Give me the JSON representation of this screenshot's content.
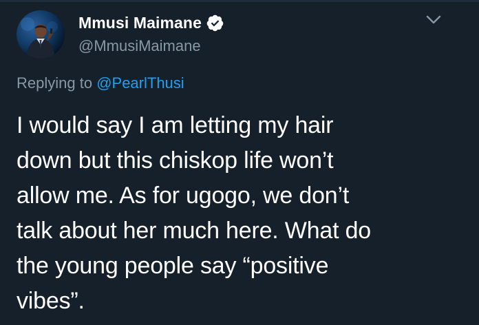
{
  "tweet": {
    "author": {
      "display_name": "Mmusi Maimane",
      "handle": "@MmusiMaimane",
      "verified": true,
      "avatar_icon": "profile-photo"
    },
    "reply": {
      "prefix": "Replying to ",
      "mention": "@PearlThusi"
    },
    "text": "I would say I am letting my hair\ndown but this chiskop life won’t\nallow me. As for ugogo, we don’t\ntalk about her much here. What do\nthe young people say “positive\nvibes”."
  },
  "colors": {
    "background": "#15202b",
    "text_primary": "#ffffff",
    "text_secondary": "#8899a6",
    "accent": "#1da1f2"
  },
  "icons": {
    "verified": "verified-badge-icon",
    "menu": "chevron-down-icon"
  }
}
